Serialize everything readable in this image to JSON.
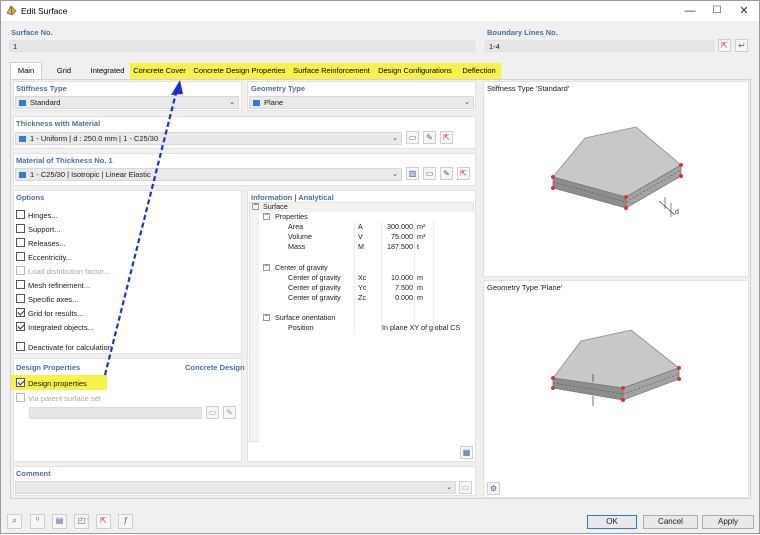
{
  "window": {
    "title": "Edit Surface",
    "min": "—",
    "max": "☐",
    "close": "✕"
  },
  "surface_no": {
    "label": "Surface No.",
    "value": "1"
  },
  "boundary": {
    "label": "Boundary Lines No.",
    "value": "1-4"
  },
  "tabs": [
    "Main",
    "Grid",
    "Integrated",
    "Concrete Cover",
    "Concrete Design Properties",
    "Surface Reinforcement",
    "Design Configurations",
    "Deflection"
  ],
  "stiffness": {
    "label": "Stiffness Type",
    "value": "Standard"
  },
  "geometry": {
    "label": "Geometry Type",
    "value": "Plane"
  },
  "thickness": {
    "label": "Thickness with Material",
    "value": "1 - Uniform | d : 250.0 mm | 1 - C25/30"
  },
  "material": {
    "label": "Material of Thickness No. 1",
    "value": "1 - C25/30 | Isotropic | Linear Elastic"
  },
  "options": {
    "label": "Options",
    "items": [
      {
        "label": "Hinges...",
        "checked": false,
        "disabled": false
      },
      {
        "label": "Support...",
        "checked": false,
        "disabled": false
      },
      {
        "label": "Releases...",
        "checked": false,
        "disabled": false
      },
      {
        "label": "Eccentricity...",
        "checked": false,
        "disabled": false
      },
      {
        "label": "Load distribution factor...",
        "checked": false,
        "disabled": true
      },
      {
        "label": "Mesh refinement...",
        "checked": false,
        "disabled": false
      },
      {
        "label": "Specific axes...",
        "checked": false,
        "disabled": false
      },
      {
        "label": "Grid for results...",
        "checked": true,
        "disabled": false
      },
      {
        "label": "Integrated objects...",
        "checked": true,
        "disabled": false
      },
      {
        "label": "Deactivate for calculation",
        "checked": false,
        "disabled": false
      }
    ]
  },
  "design": {
    "label": "Design Properties",
    "addon": "Concrete Design",
    "design_properties": "Design properties",
    "via_parent": "Via parent surface set"
  },
  "info": {
    "label": "Information | Analytical",
    "root": "Surface",
    "groups": [
      {
        "name": "Properties",
        "rows": [
          {
            "name": "Area",
            "sym": "A",
            "value": "300.000",
            "unit": "m²"
          },
          {
            "name": "Volume",
            "sym": "V",
            "value": "75.000",
            "unit": "m³"
          },
          {
            "name": "Mass",
            "sym": "M",
            "value": "187.500",
            "unit": "t"
          }
        ]
      },
      {
        "name": "Center of gravity",
        "rows": [
          {
            "name": "Center of gravity",
            "sym": "Xc",
            "value": "10.000",
            "unit": "m"
          },
          {
            "name": "Center of gravity",
            "sym": "Yc",
            "value": "7.500",
            "unit": "m"
          },
          {
            "name": "Center of gravity",
            "sym": "Zc",
            "value": "0.000",
            "unit": "m"
          }
        ]
      },
      {
        "name": "Surface orientation",
        "rows": [
          {
            "name": "Position",
            "sym": "",
            "value": "In plane XY of global CS",
            "unit": ""
          }
        ]
      }
    ]
  },
  "stiffness_preview": {
    "label": "Stiffness Type 'Standard'"
  },
  "geometry_preview": {
    "label": "Geometry Type 'Plane'"
  },
  "comment": {
    "label": "Comment",
    "value": ""
  },
  "buttons": {
    "ok": "OK",
    "cancel": "Cancel",
    "apply": "Apply"
  },
  "colors": {
    "highlight": "#f5f24a",
    "accent": "#2e7ad1",
    "arrow": "#1d2ed8",
    "section": "#4a6f9a"
  }
}
